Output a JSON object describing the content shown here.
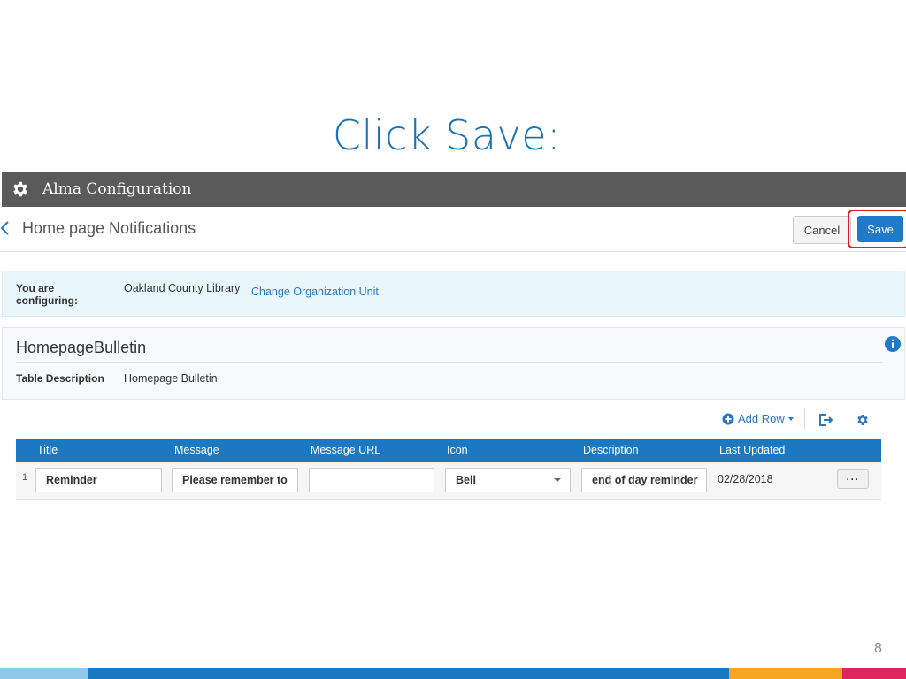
{
  "slide": {
    "title": "Click Save:",
    "page_number": "8"
  },
  "app": {
    "title": "Alma Configuration"
  },
  "page": {
    "heading": "Home page Notifications",
    "cancel_label": "Cancel",
    "save_label": "Save"
  },
  "config": {
    "label": "You are configuring:",
    "value": "Oakland County Library",
    "link": "Change Organization Unit"
  },
  "table_info": {
    "name": "HomepageBulletin",
    "desc_label": "Table Description",
    "desc_value": "Homepage Bulletin"
  },
  "toolbar": {
    "add_row_label": "Add Row"
  },
  "grid": {
    "columns": [
      "Title",
      "Message",
      "Message URL",
      "Icon",
      "Description",
      "Last Updated"
    ],
    "rows": [
      {
        "num": "1",
        "title": "Reminder",
        "message": "Please remember to",
        "message_url": "",
        "icon": "Bell",
        "description": "end of day reminder",
        "last_updated": "02/28/2018",
        "actions_label": "···"
      }
    ]
  },
  "icons": {
    "app_header": "gear-icon",
    "back": "chevron-left-icon",
    "info": "info-icon",
    "add_row": "plus-circle-icon",
    "export": "export-icon",
    "settings": "gear-icon",
    "select": "caret-down-icon"
  },
  "colors": {
    "slide_title": "#1a73b7",
    "header_bg": "#5a5a5a",
    "primary": "#1f7ac9",
    "highlight": "#d8202c",
    "grid_header": "#1a79c2",
    "config_bg": "#e9f6fc"
  }
}
